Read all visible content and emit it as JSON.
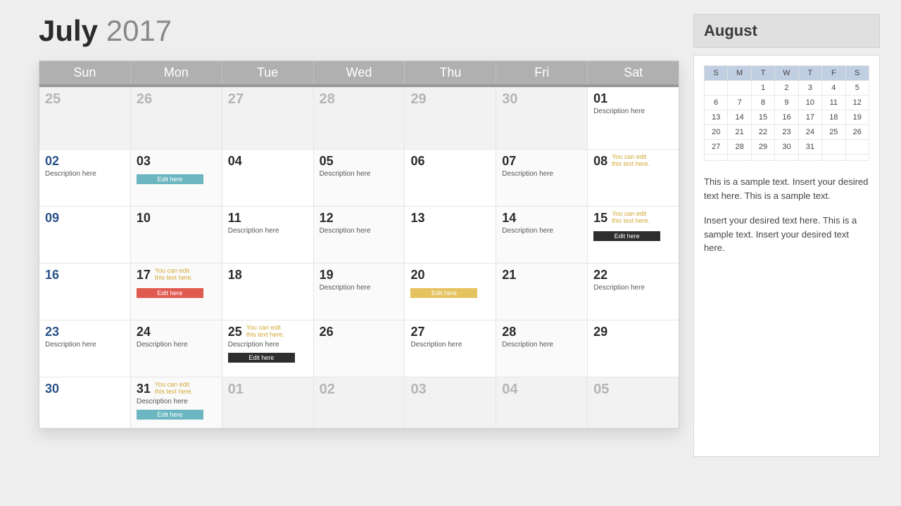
{
  "title": {
    "month": "July",
    "year": "2017"
  },
  "dayHeaders": [
    "Sun",
    "Mon",
    "Tue",
    "Wed",
    "Thu",
    "Fri",
    "Sat"
  ],
  "weeks": [
    [
      {
        "n": "25",
        "out": true
      },
      {
        "n": "26",
        "out": true
      },
      {
        "n": "27",
        "out": true
      },
      {
        "n": "28",
        "out": true
      },
      {
        "n": "29",
        "out": true
      },
      {
        "n": "30",
        "out": true
      },
      {
        "n": "01",
        "desc": "Description here"
      }
    ],
    [
      {
        "n": "02",
        "sun": true,
        "desc": "Description here"
      },
      {
        "n": "03",
        "tag": {
          "text": "Edit here",
          "color": "teal"
        }
      },
      {
        "n": "04"
      },
      {
        "n": "05",
        "desc": "Description here"
      },
      {
        "n": "06"
      },
      {
        "n": "07",
        "desc": "Description here"
      },
      {
        "n": "08",
        "note": "You can edit this text here."
      }
    ],
    [
      {
        "n": "09",
        "sun": true
      },
      {
        "n": "10"
      },
      {
        "n": "11",
        "desc": "Description here"
      },
      {
        "n": "12",
        "desc": "Description here"
      },
      {
        "n": "13"
      },
      {
        "n": "14",
        "desc": "Description here"
      },
      {
        "n": "15",
        "note": "You can edit this text here.",
        "tag": {
          "text": "Edit here",
          "color": "dark"
        }
      }
    ],
    [
      {
        "n": "16",
        "sun": true
      },
      {
        "n": "17",
        "note": "You can edit this text here.",
        "tag": {
          "text": "Edit here",
          "color": "red"
        }
      },
      {
        "n": "18"
      },
      {
        "n": "19",
        "desc": "Description here"
      },
      {
        "n": "20",
        "tag": {
          "text": "Edit here",
          "color": "yellow"
        }
      },
      {
        "n": "21"
      },
      {
        "n": "22",
        "desc": "Description here"
      }
    ],
    [
      {
        "n": "23",
        "sun": true,
        "desc": "Description here"
      },
      {
        "n": "24",
        "desc": "Description here"
      },
      {
        "n": "25",
        "note": "You can edit this text here.",
        "desc": "Description here",
        "tag": {
          "text": "Edit here",
          "color": "dark"
        }
      },
      {
        "n": "26"
      },
      {
        "n": "27",
        "desc": "Description here"
      },
      {
        "n": "28",
        "desc": "Description here"
      },
      {
        "n": "29"
      }
    ],
    [
      {
        "n": "30",
        "sun": true
      },
      {
        "n": "31",
        "note": "You can edit this text here.",
        "desc": "Description here",
        "tag": {
          "text": "Edit here",
          "color": "teal"
        }
      },
      {
        "n": "01",
        "out": true
      },
      {
        "n": "02",
        "out": true
      },
      {
        "n": "03",
        "out": true
      },
      {
        "n": "04",
        "out": true
      },
      {
        "n": "05",
        "out": true
      }
    ]
  ],
  "side": {
    "title": "August",
    "miniHeaders": [
      "S",
      "M",
      "T",
      "W",
      "T",
      "F",
      "S"
    ],
    "miniWeeks": [
      [
        "",
        "",
        "1",
        "2",
        "3",
        "4",
        "5"
      ],
      [
        "6",
        "7",
        "8",
        "9",
        "10",
        "11",
        "12"
      ],
      [
        "13",
        "14",
        "15",
        "16",
        "17",
        "18",
        "19"
      ],
      [
        "20",
        "21",
        "22",
        "23",
        "24",
        "25",
        "26"
      ],
      [
        "27",
        "28",
        "29",
        "30",
        "31",
        "",
        ""
      ],
      [
        "",
        "",
        "",
        "",
        "",
        "",
        ""
      ]
    ],
    "paragraph1": "This is a sample text. Insert your desired text here. This is a sample text.",
    "paragraph2": "Insert your desired text here. This is a sample text. Insert your desired text here."
  }
}
